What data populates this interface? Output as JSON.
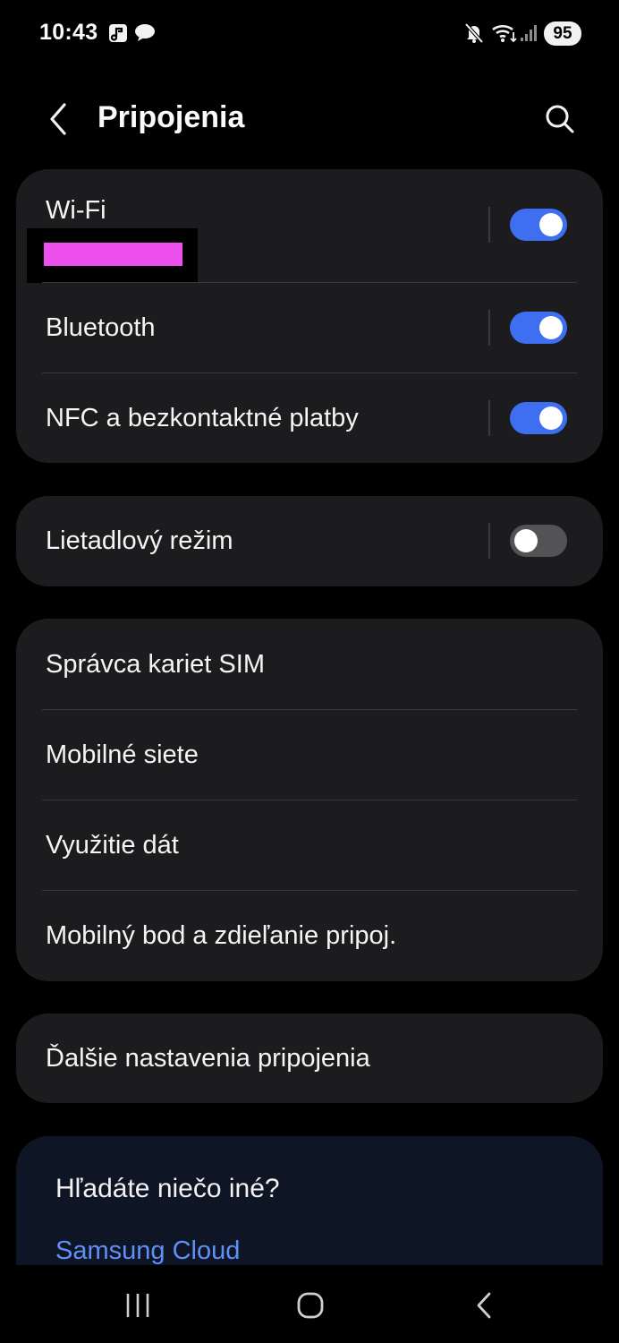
{
  "status_bar": {
    "time": "10:43",
    "left_icons": [
      "music-note-icon",
      "chat-bubble-icon"
    ],
    "right_icons": [
      "mute-icon",
      "wifi-icon",
      "signal-icon"
    ],
    "battery": "95"
  },
  "header": {
    "title": "Pripojenia",
    "back_icon": "chevron-left-icon",
    "search_icon": "search-icon"
  },
  "groups": {
    "connectivity": {
      "wifi": {
        "label": "Wi-Fi",
        "enabled": true
      },
      "bluetooth": {
        "label": "Bluetooth",
        "enabled": true
      },
      "nfc": {
        "label": "NFC a bezkontaktné platby",
        "enabled": true
      }
    },
    "airplane": {
      "label": "Lietadlový režim",
      "enabled": false
    },
    "sim": {
      "items": [
        {
          "label": "Správca kariet SIM"
        },
        {
          "label": "Mobilné siete"
        },
        {
          "label": "Využitie dát"
        },
        {
          "label": "Mobilný bod a zdieľanie pripoj."
        }
      ]
    },
    "more": {
      "label": "Ďalšie nastavenia pripojenia"
    }
  },
  "suggestion": {
    "title": "Hľadáte niečo iné?",
    "link": "Samsung Cloud"
  },
  "nav_bar": {
    "icons": [
      "recent-apps-icon",
      "home-icon",
      "back-icon"
    ]
  },
  "colors": {
    "background": "#000000",
    "card": "#1c1c1e",
    "toggle_on": "#3e6ff0",
    "toggle_off": "#535355",
    "link": "#5f8ff7",
    "suggestion_card": "#0e1524",
    "redaction": "#ee50ee"
  }
}
